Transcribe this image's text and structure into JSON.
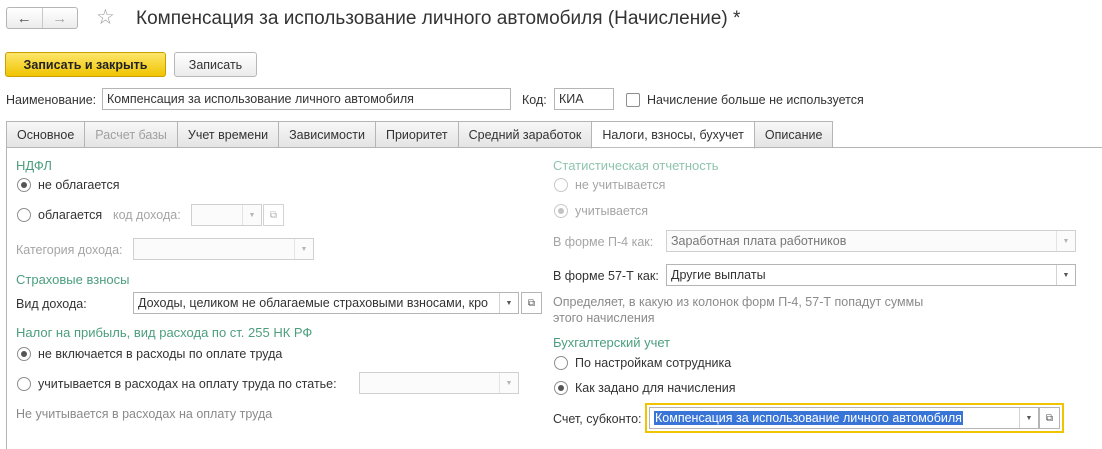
{
  "header": {
    "back_icon": "arrow-left-icon",
    "forward_icon": "arrow-right-icon",
    "favorite_icon": "star-icon",
    "title": "Компенсация за использование личного автомобиля (Начисление) *"
  },
  "toolbar": {
    "save_close_label": "Записать и закрыть",
    "save_label": "Записать"
  },
  "form": {
    "name_label": "Наименование:",
    "name_value": "Компенсация за использование личного автомобиля",
    "code_label": "Код:",
    "code_value": "КИА",
    "unused_label": "Начисление больше не используется",
    "unused_checked": false
  },
  "tabs": [
    {
      "label": "Основное",
      "active": false,
      "disabled": false
    },
    {
      "label": "Расчет базы",
      "active": false,
      "disabled": true
    },
    {
      "label": "Учет времени",
      "active": false,
      "disabled": false
    },
    {
      "label": "Зависимости",
      "active": false,
      "disabled": false
    },
    {
      "label": "Приоритет",
      "active": false,
      "disabled": false
    },
    {
      "label": "Средний заработок",
      "active": false,
      "disabled": false
    },
    {
      "label": "Налоги, взносы, бухучет",
      "active": true,
      "disabled": false
    },
    {
      "label": "Описание",
      "active": false,
      "disabled": false
    }
  ],
  "ndfl": {
    "title": "НДФЛ",
    "not_taxed_label": "не облагается",
    "taxed_label": "облагается",
    "income_code_label": "код дохода:",
    "income_code_value": "",
    "income_category_label": "Категория дохода:",
    "income_category_value": "",
    "selected": "not_taxed"
  },
  "insurance": {
    "title": "Страховые взносы",
    "income_type_label": "Вид дохода:",
    "income_type_value": "Доходы, целиком не облагаемые страховыми взносами, кро"
  },
  "profit_tax": {
    "title": "Налог на прибыль, вид расхода по ст. 255 НК РФ",
    "not_included_label": "не включается в расходы по оплате труда",
    "included_label": "учитывается в расходах на оплату труда по статье:",
    "article_value": "",
    "selected": "not_included",
    "hint": "Не учитывается в расходах на оплату труда"
  },
  "statistics": {
    "title": "Статистическая отчетность",
    "not_counted_label": "не учитывается",
    "counted_label": "учитывается",
    "selected": "counted",
    "p4_label": "В форме П-4 как:",
    "p4_value": "Заработная плата работников",
    "f57_label": "В форме 57-Т как:",
    "f57_value": "Другие выплаты",
    "hint_line1": "Определяет, в какую из колонок форм П-4, 57-Т попадут суммы",
    "hint_line2": "этого начисления"
  },
  "accounting": {
    "title": "Бухгалтерский учет",
    "by_employee_label": "По настройкам сотрудника",
    "as_set_label": "Как задано для начисления",
    "selected": "as_set",
    "account_label": "Счет, субконто:",
    "account_value": "Компенсация за использование личного автомобиля"
  },
  "colors": {
    "accent_green": "#4c9e7f",
    "primary_button": "#f0c400",
    "selection": "#3875d7"
  }
}
